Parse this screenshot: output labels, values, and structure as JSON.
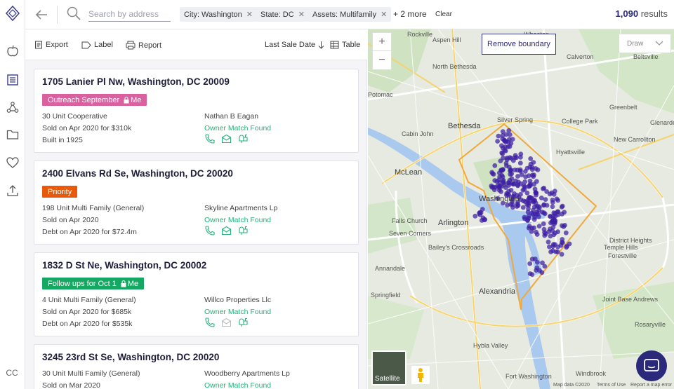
{
  "search": {
    "placeholder": "Search by address"
  },
  "filters": [
    {
      "label": "City: Washington"
    },
    {
      "label": "State: DC"
    },
    {
      "label": "Assets: Multifamily"
    }
  ],
  "more_filters": "+ 2 more",
  "clear_label": "Clear",
  "results": {
    "count": "1,090",
    "label": "results"
  },
  "rail": {
    "user_initials": "CC"
  },
  "toolbar": {
    "export": "Export",
    "label": "Label",
    "report": "Report",
    "sort": "Last Sale Date",
    "view": "Table"
  },
  "properties": [
    {
      "address": "1705 Lanier Pl Nw, Washington, DC 20009",
      "tag": "Outreach September",
      "tag_owner": "Me",
      "tag_color": "#d9619f",
      "details": [
        "30 Unit Cooperative",
        "Sold on Apr 2020 for $310k",
        "Built in 1925"
      ],
      "owner": "Nathan B Eagan",
      "owner_status": "Owner Match Found"
    },
    {
      "address": "2400 Elvans Rd Se, Washington, DC 20020",
      "tag": "Priority",
      "tag_owner": "",
      "tag_color": "#e8590c",
      "details": [
        "198 Unit Multi Family (General)",
        "Sold on Apr 2020",
        "Debt on Apr 2020 for $72.4m"
      ],
      "owner": "Skyline Apartments Lp",
      "owner_status": "Owner Match Found"
    },
    {
      "address": "1832 D St Ne, Washington, DC 20002",
      "tag": "Follow ups for Oct 1",
      "tag_owner": "Me",
      "tag_color": "#15a862",
      "details": [
        "4 Unit Multi Family (General)",
        "Sold on Apr 2020 for $685k",
        "Debt on Apr 2020 for $535k"
      ],
      "owner": "Willco Properties Llc",
      "owner_status": "Owner Match Found"
    },
    {
      "address": "3245 23rd St Se, Washington, DC 20020",
      "details": [
        "30 Unit Multi Family (General)",
        "Sold on Mar 2020"
      ],
      "owner": "Woodberry Apartments Lp",
      "owner_status": "Owner Match Found"
    }
  ],
  "map": {
    "remove_boundary": "Remove boundary",
    "draw": "Draw",
    "satellite": "Satellite",
    "attribution": [
      "Map data ©2020",
      "Terms of Use",
      "Report a map error"
    ],
    "places": [
      "Rockville",
      "Wheaton",
      "Calverton",
      "North Bethesda",
      "Beltsville",
      "Aspen Hill",
      "Potomac",
      "Bethesda",
      "Silver Spring",
      "College Park",
      "Greenbelt",
      "Cabin John",
      "Hyattsville",
      "New Carrollton",
      "Glenarden",
      "McLean",
      "Washington",
      "Falls Church",
      "Arlington",
      "Seven Corners",
      "Bailey's Crossroads",
      "Annandale",
      "Alexandria",
      "Springfield",
      "Temple Hills",
      "Forestville",
      "Fort Washington",
      "Hybla Valley",
      "Rosaryville",
      "Windbrook",
      "District Heights",
      "Joint Base Andrews"
    ]
  },
  "colors": {
    "brand": "#2b2a7a",
    "match": "#23b37a",
    "boundary": "#f0a93b",
    "points": "#3d1fa3"
  }
}
